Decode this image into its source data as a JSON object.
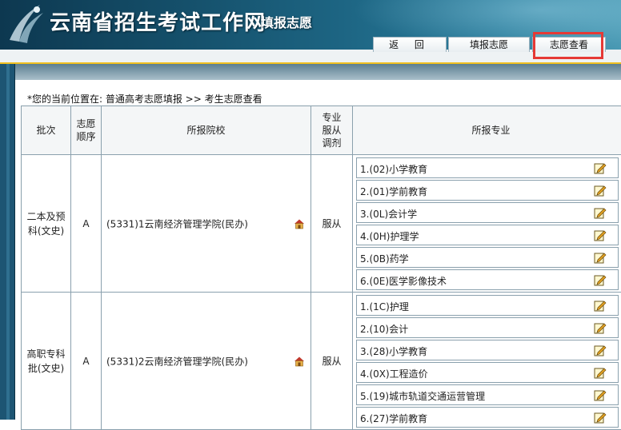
{
  "header": {
    "site_title": "云南省招生考试工作网",
    "sub_title": "填报志愿"
  },
  "nav": {
    "return_label": "返 回",
    "fill_label": "填报志愿",
    "view_label": "志愿查看"
  },
  "breadcrumb": "*您的当前位置在: 普通高考志愿填报 >> 考生志愿查看",
  "table": {
    "headers": {
      "batch": "批次",
      "order": "志愿顺序",
      "school": "所报院校",
      "adjust": "专业服从调剂",
      "majors": "所报专业"
    },
    "rows": [
      {
        "batch_line1": "二本及预",
        "batch_line2": "科(文史)",
        "order": "A",
        "school": "(5331)1云南经济管理学院(民办)",
        "adjust": "服从",
        "majors": [
          "1.(02)小学教育",
          "2.(01)学前教育",
          "3.(0L)会计学",
          "4.(0H)护理学",
          "5.(0B)药学",
          "6.(0E)医学影像技术"
        ]
      },
      {
        "batch_line1": "高职专科",
        "batch_line2": "批(文史)",
        "order": "A",
        "school": "(5331)2云南经济管理学院(民办)",
        "adjust": "服从",
        "majors": [
          "1.(1C)护理",
          "2.(10)会计",
          "3.(28)小学教育",
          "4.(0X)工程造价",
          "5.(19)城市轨道交通运营管理",
          "6.(27)学前教育"
        ]
      }
    ]
  },
  "colors": {
    "header_bg": "#15506b",
    "accent_line": "#f0c020",
    "highlight": "#e53935",
    "border": "#8aa0ad"
  },
  "icons": [
    "logo-icon",
    "house-icon",
    "edit-icon"
  ]
}
